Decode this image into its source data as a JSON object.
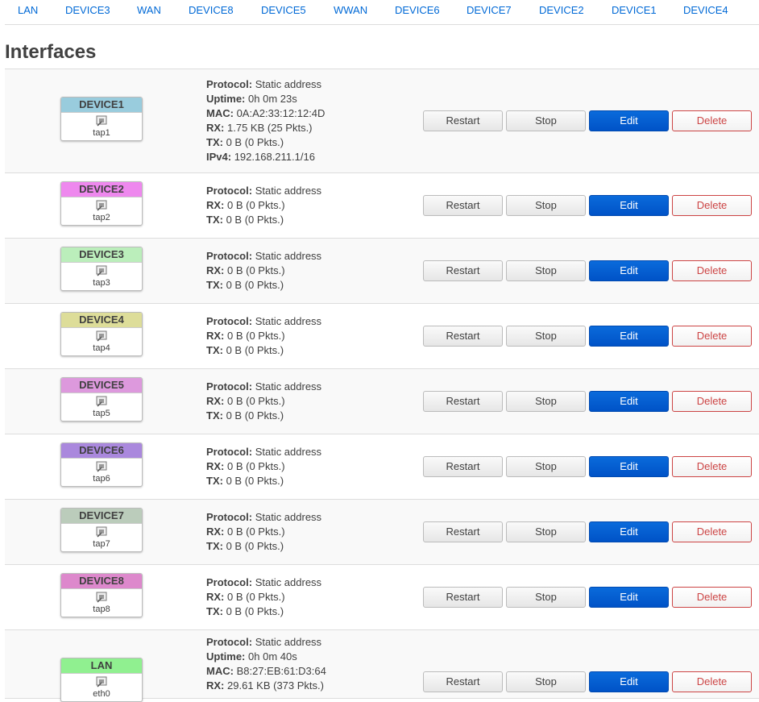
{
  "tabs": [
    "LAN",
    "DEVICE3",
    "WAN",
    "DEVICE8",
    "DEVICE5",
    "WWAN",
    "DEVICE6",
    "DEVICE7",
    "DEVICE2",
    "DEVICE1",
    "DEVICE4"
  ],
  "section_title": "Interfaces",
  "labels": {
    "protocol": "Protocol:",
    "uptime": "Uptime:",
    "mac": "MAC:",
    "rx": "RX:",
    "tx": "TX:",
    "ipv4": "IPv4:"
  },
  "buttons": {
    "restart": "Restart",
    "stop": "Stop",
    "edit": "Edit",
    "delete": "Delete"
  },
  "interfaces": [
    {
      "name": "DEVICE1",
      "device": "tap1",
      "color": "#99ccdd",
      "protocol": "Static address",
      "uptime": "0h 0m 23s",
      "mac": "0A:A2:33:12:12:4D",
      "rx": "1.75 KB (25 Pkts.)",
      "tx": "0 B (0 Pkts.)",
      "ipv4": "192.168.211.1/16"
    },
    {
      "name": "DEVICE2",
      "device": "tap2",
      "color": "#ee88ee",
      "protocol": "Static address",
      "rx": "0 B (0 Pkts.)",
      "tx": "0 B (0 Pkts.)"
    },
    {
      "name": "DEVICE3",
      "device": "tap3",
      "color": "#bbeebb",
      "protocol": "Static address",
      "rx": "0 B (0 Pkts.)",
      "tx": "0 B (0 Pkts.)"
    },
    {
      "name": "DEVICE4",
      "device": "tap4",
      "color": "#dddd99",
      "protocol": "Static address",
      "rx": "0 B (0 Pkts.)",
      "tx": "0 B (0 Pkts.)"
    },
    {
      "name": "DEVICE5",
      "device": "tap5",
      "color": "#dd99dd",
      "protocol": "Static address",
      "rx": "0 B (0 Pkts.)",
      "tx": "0 B (0 Pkts.)"
    },
    {
      "name": "DEVICE6",
      "device": "tap6",
      "color": "#aa88dd",
      "protocol": "Static address",
      "rx": "0 B (0 Pkts.)",
      "tx": "0 B (0 Pkts.)"
    },
    {
      "name": "DEVICE7",
      "device": "tap7",
      "color": "#bbccbb",
      "protocol": "Static address",
      "rx": "0 B (0 Pkts.)",
      "tx": "0 B (0 Pkts.)"
    },
    {
      "name": "DEVICE8",
      "device": "tap8",
      "color": "#dd88cc",
      "protocol": "Static address",
      "rx": "0 B (0 Pkts.)",
      "tx": "0 B (0 Pkts.)"
    },
    {
      "name": "LAN",
      "device": "eth0",
      "color": "#90f090",
      "protocol": "Static address",
      "uptime": "0h 0m 40s",
      "mac": "B8:27:EB:61:D3:64",
      "rx": "29.61 KB (373 Pkts.)"
    }
  ]
}
